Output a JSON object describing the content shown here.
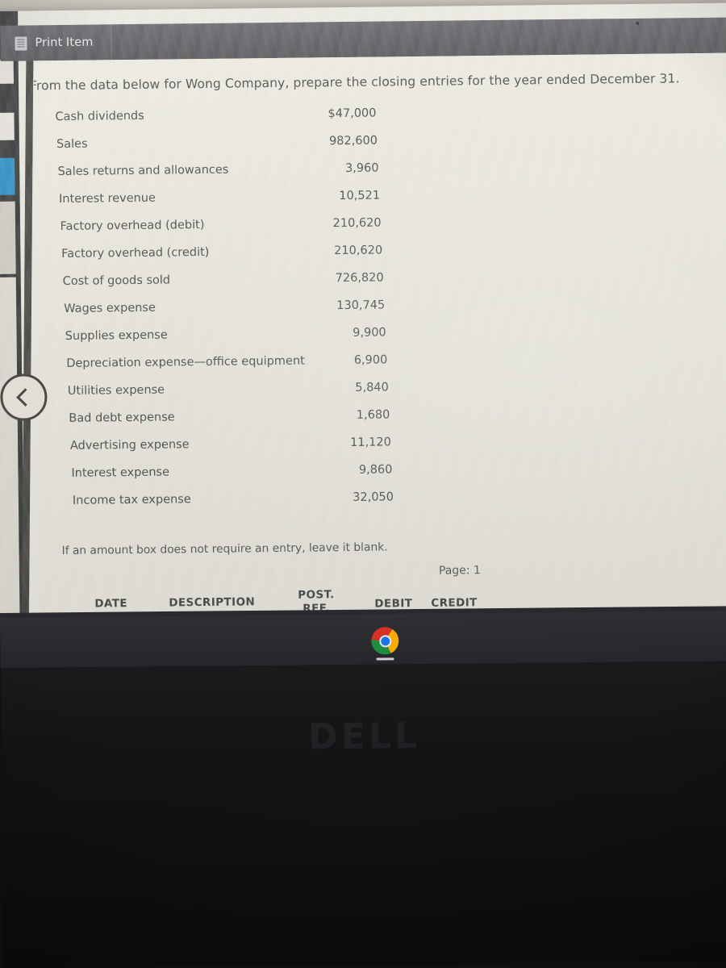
{
  "toolbar": {
    "print_item_label": "Print Item",
    "doc_icon": "document-list-icon"
  },
  "document": {
    "prompt": "From the data below for Wong Company, prepare the closing entries for the year ended December 31.",
    "instruction_note": "If an amount box does not require an entry, leave it blank.",
    "page_indicator": "Page: 1",
    "rows": [
      {
        "label": "Cash dividends",
        "amount": "$47,000"
      },
      {
        "label": "Sales",
        "amount": "982,600"
      },
      {
        "label": "Sales returns and allowances",
        "amount": "3,960"
      },
      {
        "label": "Interest revenue",
        "amount": "10,521"
      },
      {
        "label": "Factory overhead (debit)",
        "amount": "210,620"
      },
      {
        "label": "Factory overhead (credit)",
        "amount": "210,620"
      },
      {
        "label": "Cost of goods sold",
        "amount": "726,820"
      },
      {
        "label": "Wages expense",
        "amount": "130,745"
      },
      {
        "label": "Supplies expense",
        "amount": "9,900"
      },
      {
        "label": "Depreciation expense—office equipment",
        "amount": "6,900"
      },
      {
        "label": "Utilities expense",
        "amount": "5,840"
      },
      {
        "label": "Bad debt expense",
        "amount": "1,680"
      },
      {
        "label": "Advertising expense",
        "amount": "11,120"
      },
      {
        "label": "Interest expense",
        "amount": "9,860"
      },
      {
        "label": "Income tax expense",
        "amount": "32,050"
      }
    ]
  },
  "journal": {
    "headers": {
      "date": "DATE",
      "description": "DESCRIPTION",
      "post_ref_line1": "POST.",
      "post_ref_line2": "REF.",
      "debit": "DEBIT",
      "credit": "CREDIT"
    }
  },
  "controls": {
    "back_button_label": "previous",
    "back_icon": "chevron-left-icon",
    "submit_button_label": ""
  },
  "taskbar": {
    "chrome_icon": "chrome-browser-icon"
  },
  "hardware": {
    "brand_logo": "DELL"
  },
  "colors": {
    "toolbar_gray": "#5c5b60",
    "page_bg": "#e9e7dd",
    "text": "#4d4d4f",
    "accent_blue": "#2b7fae",
    "sidebar_blue": "#2e8fc4",
    "bezel_black": "#141416"
  }
}
